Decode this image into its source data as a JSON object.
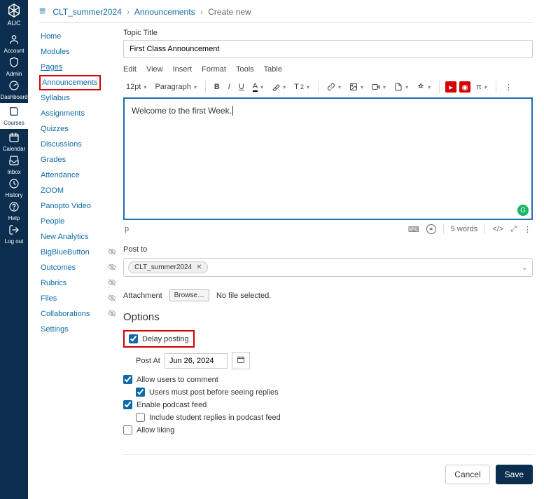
{
  "brand": "AUC",
  "global_nav": [
    {
      "label": "Account",
      "icon": "account"
    },
    {
      "label": "Admin",
      "icon": "shield"
    },
    {
      "label": "Dashboard",
      "icon": "gauge"
    },
    {
      "label": "Courses",
      "icon": "book",
      "active": true
    },
    {
      "label": "Calendar",
      "icon": "calendar"
    },
    {
      "label": "Inbox",
      "icon": "inbox"
    },
    {
      "label": "History",
      "icon": "clock"
    },
    {
      "label": "Help",
      "icon": "help"
    },
    {
      "label": "Log out",
      "icon": "logout"
    }
  ],
  "breadcrumb": {
    "course": "CLT_summer2024",
    "section": "Announcements",
    "current": "Create new"
  },
  "course_nav": [
    {
      "label": "Home"
    },
    {
      "label": "Modules"
    },
    {
      "label": "Pages"
    },
    {
      "label": "Announcements",
      "selected": true
    },
    {
      "label": "Syllabus"
    },
    {
      "label": "Assignments"
    },
    {
      "label": "Quizzes"
    },
    {
      "label": "Discussions"
    },
    {
      "label": "Grades"
    },
    {
      "label": "Attendance"
    },
    {
      "label": "ZOOM"
    },
    {
      "label": "Panopto Video"
    },
    {
      "label": "People"
    },
    {
      "label": "New Analytics"
    },
    {
      "label": "BigBlueButton",
      "hidden": true
    },
    {
      "label": "Outcomes",
      "hidden": true
    },
    {
      "label": "Rubrics",
      "hidden": true
    },
    {
      "label": "Files",
      "hidden": true
    },
    {
      "label": "Collaborations",
      "hidden": true
    },
    {
      "label": "Settings"
    }
  ],
  "form": {
    "topic_label": "Topic Title",
    "topic_value": "First Class Announcement",
    "rte_menu": [
      "Edit",
      "View",
      "Insert",
      "Format",
      "Tools",
      "Table"
    ],
    "font_size": "12pt",
    "block": "Paragraph",
    "body": "Welcome to the first Week.",
    "status_path": "p",
    "word_count": "5 words",
    "post_to_label": "Post to",
    "post_to_chip": "CLT_summer2024",
    "attachment_label": "Attachment",
    "browse_label": "Browse…",
    "no_file": "No file selected.",
    "options_heading": "Options",
    "opts": {
      "delay": {
        "label": "Delay posting",
        "checked": true
      },
      "post_at_label": "Post At",
      "post_at_value": "Jun 26, 2024",
      "allow_comment": {
        "label": "Allow users to comment",
        "checked": true
      },
      "must_post": {
        "label": "Users must post before seeing replies",
        "checked": true
      },
      "podcast": {
        "label": "Enable podcast feed",
        "checked": true
      },
      "podcast_student": {
        "label": "Include student replies in podcast feed",
        "checked": false
      },
      "liking": {
        "label": "Allow liking",
        "checked": false
      }
    },
    "cancel": "Cancel",
    "save": "Save"
  }
}
